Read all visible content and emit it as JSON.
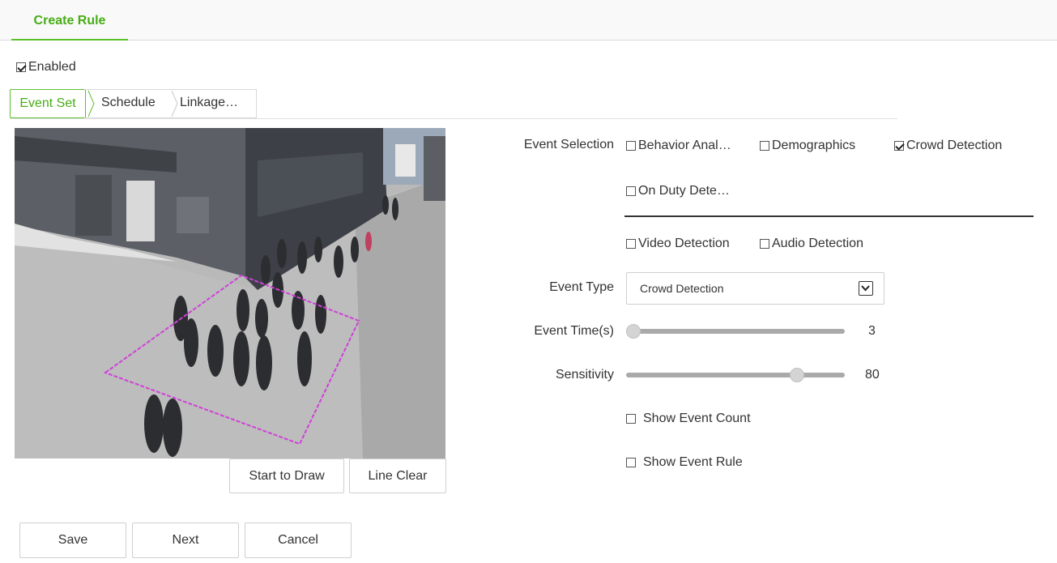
{
  "header": {
    "tab_label": "Create Rule"
  },
  "enabled": {
    "label": "Enabled",
    "checked": true
  },
  "steps": [
    {
      "label": "Event Set",
      "active": true
    },
    {
      "label": "Schedule",
      "active": false
    },
    {
      "label": "Linkage…",
      "active": false
    }
  ],
  "video_buttons": {
    "start_draw": "Start to Draw",
    "line_clear": "Line Clear"
  },
  "event_selection": {
    "label": "Event Selection",
    "options": [
      {
        "label": "Behavior Anal…",
        "checked": false
      },
      {
        "label": "Demographics",
        "checked": false
      },
      {
        "label": "Crowd Detection",
        "checked": true
      },
      {
        "label": "On Duty Dete…",
        "checked": false
      },
      {
        "label": "Video Detection",
        "checked": false
      },
      {
        "label": "Audio Detection",
        "checked": false
      }
    ]
  },
  "event_type": {
    "label": "Event Type",
    "value": "Crowd Detection"
  },
  "event_time": {
    "label": "Event Time(s)",
    "value": "3",
    "fraction": 0.0
  },
  "sensitivity": {
    "label": "Sensitivity",
    "value": "80",
    "fraction": 0.8
  },
  "show_event_count": {
    "label": "Show Event Count",
    "checked": false
  },
  "show_event_rule": {
    "label": "Show Event Rule",
    "checked": false
  },
  "footer": {
    "save": "Save",
    "next": "Next",
    "cancel": "Cancel"
  },
  "colors": {
    "accent": "#47ad13",
    "rule_outline": "#d040d8"
  }
}
